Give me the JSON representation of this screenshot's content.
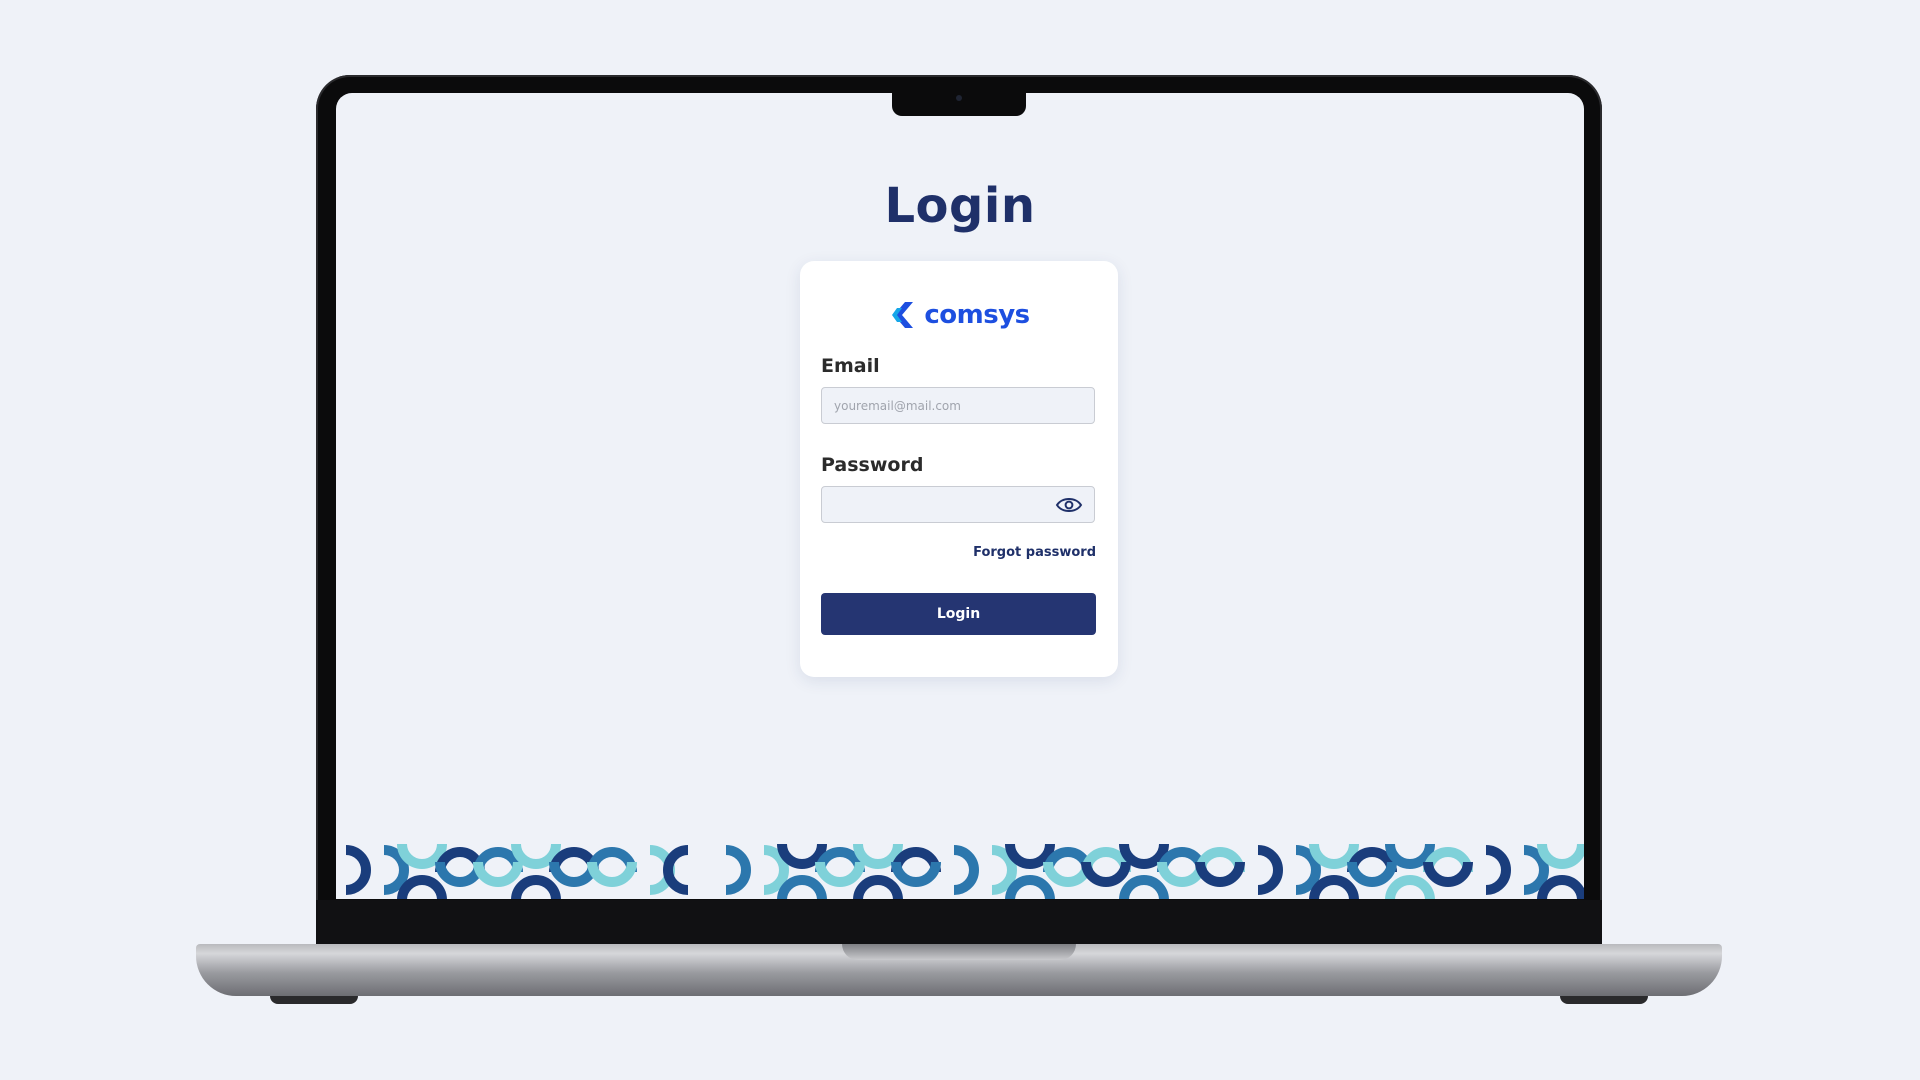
{
  "page": {
    "title": "Login"
  },
  "brand": {
    "name": "comsys",
    "primary_color": "#1d4fe0",
    "accent_color": "#16a6e8"
  },
  "form": {
    "email_label": "Email",
    "email_placeholder": "youremail@mail.com",
    "email_value": "",
    "password_label": "Password",
    "password_value": "",
    "forgot_label": "Forgot password",
    "submit_label": "Login"
  },
  "icons": {
    "password_toggle": "eye-icon",
    "logo": "comsys-logo-icon"
  },
  "colors": {
    "title": "#1f3069",
    "button": "#253572",
    "pattern_dark": "#1a3d7c",
    "pattern_mid": "#2c77ad",
    "pattern_light": "#7fd1d9"
  }
}
